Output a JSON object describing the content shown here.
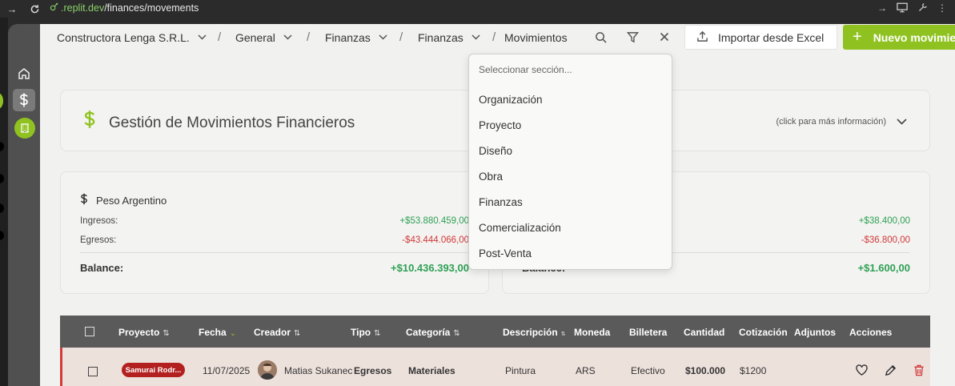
{
  "browser": {
    "url_domain": ".replit.dev",
    "url_path": "/finances/movements"
  },
  "breadcrumb": {
    "items": [
      {
        "label": "Constructora Lenga S.R.L.",
        "has_dropdown": true
      },
      {
        "label": "General",
        "has_dropdown": true
      },
      {
        "label": "Finanzas",
        "has_dropdown": true
      },
      {
        "label": "Finanzas",
        "has_dropdown": true
      },
      {
        "label": "Movimientos",
        "has_dropdown": false
      }
    ],
    "separator": "/"
  },
  "toolbar": {
    "import_label": "Importar desde Excel",
    "new_label": "Nuevo movimiento",
    "new_plus": "+"
  },
  "header": {
    "icon": "dollar-icon",
    "title": "Gestión de Movimientos Financieros",
    "hint": "(click para más información)"
  },
  "currencies": [
    {
      "name": "Peso Argentino",
      "icon": "dollar-icon",
      "income_label": "Ingresos:",
      "income": "+$53.880.459,00",
      "expense_label": "Egresos:",
      "expense": "-$43.444.066,00",
      "balance_label": "Balance:",
      "balance": "+$10.436.393,00"
    },
    {
      "name": "",
      "income": "+$38.400,00",
      "expense": "-$36.800,00",
      "balance_label": "Balance:",
      "balance": "+$1.600,00"
    }
  ],
  "table": {
    "columns": [
      "Proyecto",
      "Fecha",
      "Creador",
      "Tipo",
      "Categoría",
      "Descripción",
      "Moneda",
      "Billetera",
      "Cantidad",
      "Cotización",
      "Adjuntos",
      "Acciones"
    ],
    "rows": [
      {
        "proyecto": "Samurai Rodr...",
        "fecha": "11/07/2025",
        "creador": "Matias Sukanec",
        "tipo": "Egresos",
        "categoria": "Materiales",
        "descripcion": "Pintura",
        "moneda": "ARS",
        "billetera": "Efectivo",
        "cantidad": "$100.000",
        "cotizacion": "$1200"
      }
    ]
  },
  "section_dropdown": {
    "placeholder": "Seleccionar sección...",
    "options": [
      "Organización",
      "Proyecto",
      "Diseño",
      "Obra",
      "Finanzas",
      "Comercialización",
      "Post-Venta"
    ]
  },
  "colors": {
    "accent": "#8fc220",
    "positive": "#2fa055",
    "negative": "#cf3a3a",
    "project_badge": "#b22020",
    "table_header": "#5a5a5a"
  }
}
